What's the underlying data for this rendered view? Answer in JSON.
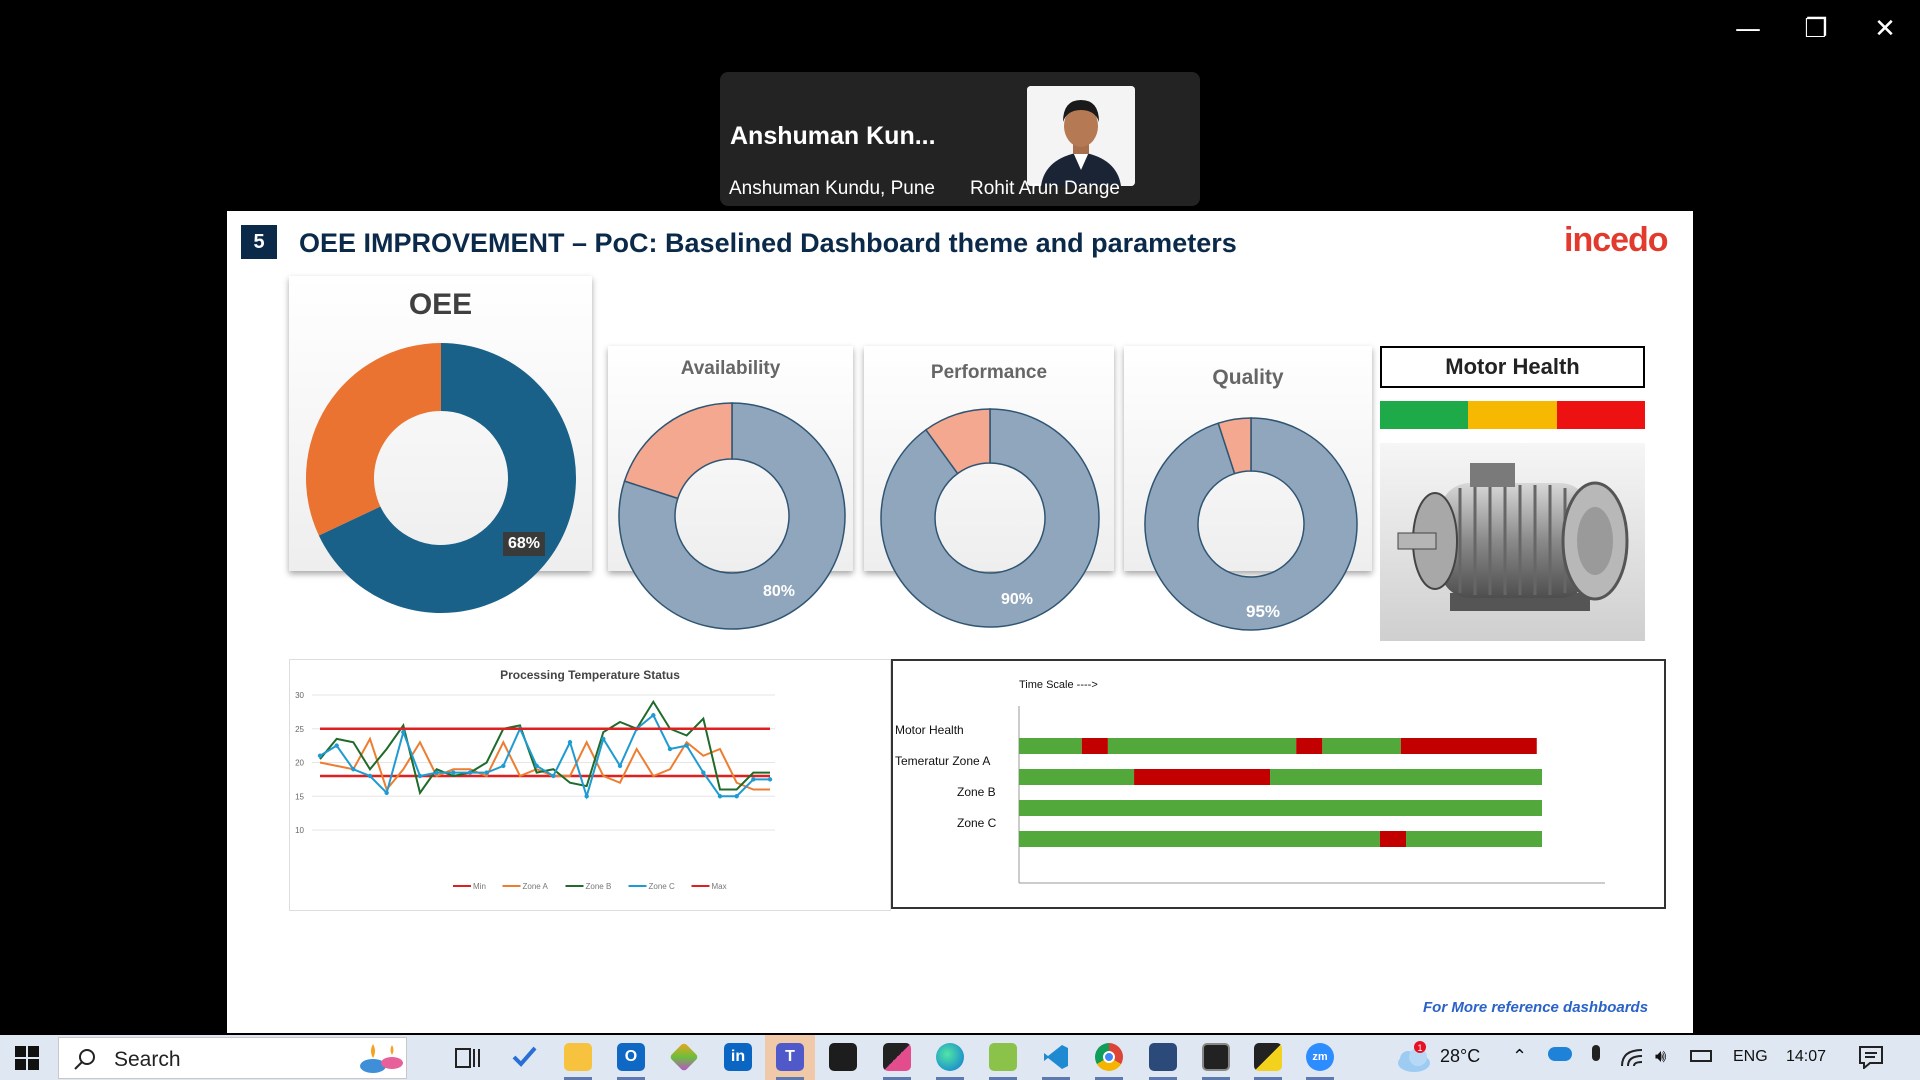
{
  "window": {
    "minimize": "—",
    "restore": "❐",
    "close": "✕"
  },
  "participants": [
    {
      "display_name": "Anshuman  Kun...",
      "label": "Anshuman Kundu, Pune"
    },
    {
      "label": "Rohit Arun Dange"
    }
  ],
  "slide": {
    "number": "5",
    "title": "OEE IMPROVEMENT – PoC: Baselined Dashboard theme and parameters",
    "logo": "incedo",
    "footer_link": "For More reference dashboards",
    "kpis": [
      {
        "name": "OEE",
        "value": 68,
        "label": "68%"
      },
      {
        "name": "Availability",
        "value": 80,
        "label": "80%"
      },
      {
        "name": "Performance",
        "value": 90,
        "label": "90%"
      },
      {
        "name": "Quality",
        "value": 95,
        "label": "95%"
      }
    ],
    "motor_health": {
      "title": "Motor Health",
      "colors": [
        "#1eaa48",
        "#f6b800",
        "#ee1111"
      ]
    },
    "colors": {
      "oee_main": "#1a6189",
      "oee_rest": "#ea7331",
      "kpi_main": "#90a6bc",
      "kpi_rest": "#f4a88f",
      "ok": "#52a83a",
      "bad": "#c20000"
    },
    "timeline": {
      "scale_label": "Time Scale ---->",
      "rows": [
        {
          "label": "Motor Health",
          "segments": [
            [
              "ok",
              0.12
            ],
            [
              "bad",
              0.05
            ],
            [
              "ok",
              0.36
            ],
            [
              "bad",
              0.05
            ],
            [
              "ok",
              0.15
            ],
            [
              "bad",
              0.26
            ]
          ]
        },
        {
          "label": "Temeratur Zone A",
          "segments": [
            [
              "ok",
              0.22
            ],
            [
              "bad",
              0.26
            ],
            [
              "ok",
              0.52
            ]
          ]
        },
        {
          "label": "Zone B",
          "segments": [
            [
              "ok",
              1.0
            ]
          ]
        },
        {
          "label": "Zone C",
          "segments": [
            [
              "ok",
              0.69
            ],
            [
              "bad",
              0.05
            ],
            [
              "ok",
              0.26
            ]
          ]
        }
      ]
    }
  },
  "chart_data": {
    "type": "line",
    "title": "Processing Temperature Status",
    "ylim": [
      10,
      30
    ],
    "yticks": [
      "10",
      "15",
      "20",
      "25",
      "30"
    ],
    "x": [
      1,
      2,
      3,
      4,
      5,
      6,
      7,
      8,
      9,
      10,
      11,
      12,
      13,
      14,
      15,
      16,
      17,
      18,
      19,
      20,
      21,
      22,
      23,
      24,
      25,
      26,
      27,
      28
    ],
    "series": [
      {
        "name": "Min",
        "color": "#e02020",
        "values": [
          18,
          18,
          18,
          18,
          18,
          18,
          18,
          18,
          18,
          18,
          18,
          18,
          18,
          18,
          18,
          18,
          18,
          18,
          18,
          18,
          18,
          18,
          18,
          18,
          18,
          18,
          18,
          18
        ]
      },
      {
        "name": "Zone A",
        "color": "#ed7d31",
        "values": [
          20,
          19.5,
          19,
          23.5,
          16,
          19,
          23,
          18,
          19,
          19,
          18,
          23,
          18,
          19,
          18,
          18,
          23,
          18,
          17,
          22,
          18,
          19,
          23,
          21,
          22,
          17,
          16,
          16
        ]
      },
      {
        "name": "Zone B",
        "color": "#1e6b2a",
        "values": [
          20.5,
          23.5,
          23,
          19,
          22,
          25.5,
          15.5,
          19,
          18,
          18.5,
          20,
          25,
          25.5,
          18.5,
          19,
          17,
          16.5,
          24.5,
          26,
          25,
          29,
          25,
          24,
          26.5,
          16,
          16,
          18.5,
          18.5
        ]
      },
      {
        "name": "Zone C",
        "color": "#1f9bd1",
        "values": [
          21,
          22.5,
          19,
          18,
          15.5,
          24.5,
          18,
          18.5,
          18.5,
          18.5,
          18.5,
          19.5,
          25,
          19.5,
          18,
          23,
          15,
          23.5,
          19.5,
          25,
          27,
          22,
          22.5,
          18.5,
          15,
          15,
          17.5,
          17.5
        ]
      },
      {
        "name": "Max",
        "color": "#e02020",
        "values": [
          25,
          25,
          25,
          25,
          25,
          25,
          25,
          25,
          25,
          25,
          25,
          25,
          25,
          25,
          25,
          25,
          25,
          25,
          25,
          25,
          25,
          25,
          25,
          25,
          25,
          25,
          25,
          25
        ]
      }
    ]
  },
  "taskbar": {
    "search_label": "Search",
    "weather": "28°C",
    "weather_badge": "1",
    "language": "ENG",
    "time": "14:07"
  }
}
